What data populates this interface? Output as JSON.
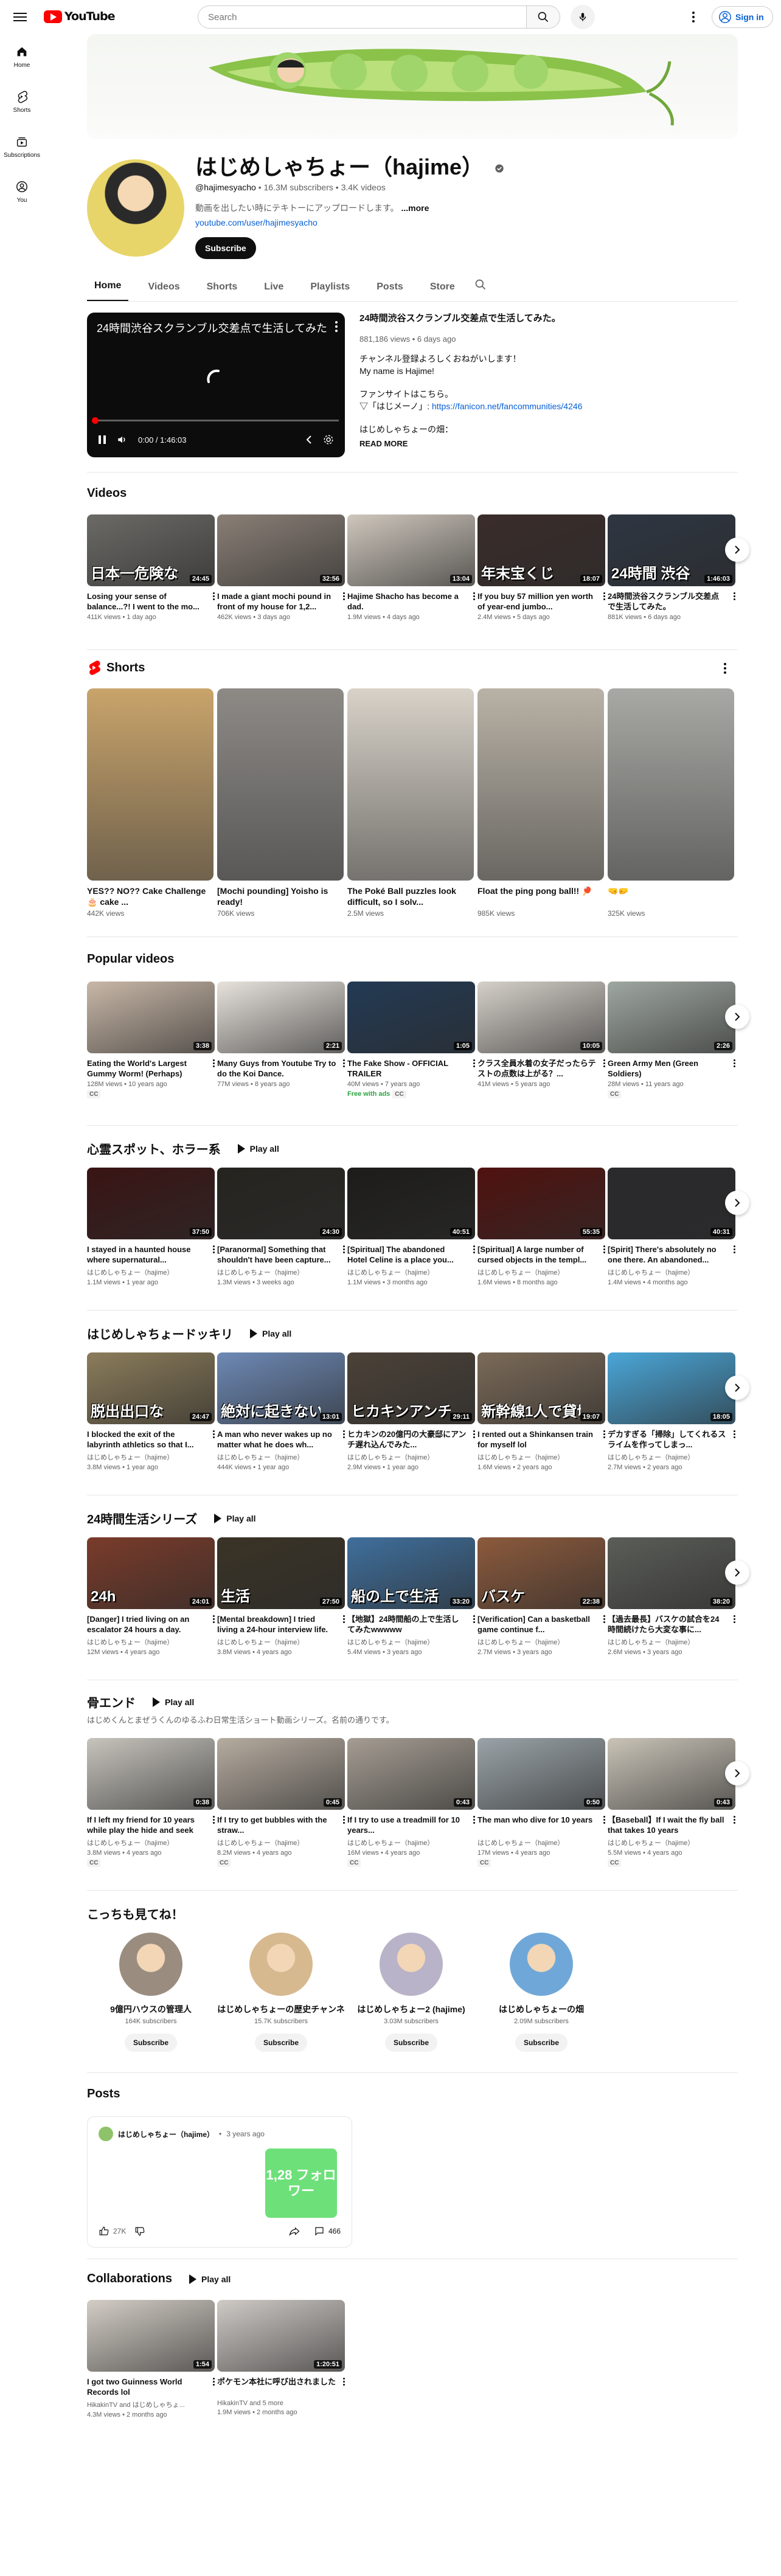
{
  "masthead": {
    "logo_text": "YouTube",
    "search_placeholder": "Search",
    "signin_label": "Sign in"
  },
  "guide": [
    {
      "label": "Home",
      "icon": "home-icon"
    },
    {
      "label": "Shorts",
      "icon": "shorts-icon"
    },
    {
      "label": "Subscriptions",
      "icon": "subscriptions-icon"
    },
    {
      "label": "You",
      "icon": "you-icon"
    }
  ],
  "channel": {
    "title": "はじめしゃちょー（hajime）",
    "handle": "@hajimesyacho",
    "subscribers": "16.3M subscribers",
    "videos": "3.4K videos",
    "description": "動画を出したい時にテキトーにアップロードします。",
    "more": "...more",
    "link": "youtube.com/user/hajimesyacho",
    "subscribe": "Subscribe"
  },
  "tabs": [
    "Home",
    "Videos",
    "Shorts",
    "Live",
    "Playlists",
    "Posts",
    "Store"
  ],
  "featured": {
    "player_title": "24時間渋谷スクランブル交差点で生活してみた。",
    "time": "0:00 / 1:46:03",
    "progress": 0,
    "title": "24時間渋谷スクランブル交差点で生活してみた。",
    "meta": "881,186 views • 6 days ago",
    "lines": [
      "チャンネル登録よろしくおねがいします！",
      "My name is Hajime!",
      "",
      "ファンサイトはこちら。",
      "はじめしゃちょーの畑："
    ],
    "fan_prefix": "▽「はじメーノ」: ",
    "fan_link": "https://fanicon.net/fancommunities/4246",
    "read_more": "READ MORE"
  },
  "sections": {
    "videos": {
      "title": "Videos",
      "items": [
        {
          "title": "Losing your sense of balance...?! I went to the mo...",
          "meta": "411K views • 1 day ago",
          "dur": "24:45",
          "caption": "日本一危険な",
          "color": "#6b6a66"
        },
        {
          "title": "I made a giant mochi pound in front of my house for 1,2...",
          "meta": "462K views • 3 days ago",
          "dur": "32:56",
          "caption": "",
          "color": "#8a7f76"
        },
        {
          "title": "Hajime Shacho has become a dad.",
          "meta": "1.9M views • 4 days ago",
          "dur": "13:04",
          "caption": "",
          "color": "#cfc7bd"
        },
        {
          "title": "If you buy 57 million yen worth of year-end jumbo...",
          "meta": "2.4M views • 5 days ago",
          "dur": "18:07",
          "caption": "年末宝くじ",
          "color": "#3a2c2a"
        },
        {
          "title": "24時間渋谷スクランブル交差点で生活してみた。",
          "meta": "881K views • 6 days ago",
          "dur": "1:46:03",
          "caption": "24時間 渋谷",
          "color": "#2e3642"
        }
      ]
    },
    "shorts": {
      "title": "Shorts",
      "items": [
        {
          "title": "YES?? NO?? Cake Challenge🎂 cake ...",
          "views": "442K views",
          "color": "#c9a46b"
        },
        {
          "title": "[Mochi pounding] Yoisho is ready!",
          "views": "706K views",
          "color": "#8d8a86"
        },
        {
          "title": "The Poké Ball puzzles look difficult, so I solv...",
          "views": "2.5M views",
          "color": "#d8d2c8"
        },
        {
          "title": "Float the ping pong ball!! 🏓",
          "views": "985K views",
          "color": "#b9b2a6"
        },
        {
          "title": "🤜🤛",
          "views": "325K views",
          "color": "#a8a8a4"
        }
      ]
    },
    "popular": {
      "title": "Popular videos",
      "items": [
        {
          "title": "Eating the World's Largest Gummy Worm! (Perhaps)",
          "meta": "128M views • 10 years ago",
          "dur": "3:38",
          "badges": [
            "CC"
          ],
          "color": "#c8b7a7"
        },
        {
          "title": "Many Guys from Youtube Try to do the Koi Dance.",
          "meta": "77M views • 8 years ago",
          "dur": "2:21",
          "badges": [],
          "color": "#e7e2dc"
        },
        {
          "title": "The Fake Show - OFFICIAL TRAILER",
          "meta": "40M views • 7 years ago",
          "dur": "1:05",
          "badges": [
            "Free with ads",
            "CC"
          ],
          "color": "#233a54"
        },
        {
          "title": "クラス全員水着の女子だったらテストの点数は上がる？...",
          "meta": "41M views • 5 years ago",
          "dur": "10:05",
          "badges": [],
          "color": "#d5d0c9"
        },
        {
          "title": "Green Army Men (Green Soldiers)",
          "meta": "28M views • 11 years ago",
          "dur": "2:26",
          "badges": [
            "CC"
          ],
          "color": "#9fa7a1"
        }
      ]
    },
    "horror": {
      "title": "心霊スポット、ホラー系",
      "play_all": "Play all",
      "items": [
        {
          "title": "I stayed in a haunted house where supernatural...",
          "channel": "はじめしゃちょー（hajime）",
          "meta": "1.1M views • 1 year ago",
          "dur": "37:50",
          "color": "#3a1414"
        },
        {
          "title": "[Paranormal] Something that shouldn't have been capture...",
          "channel": "はじめしゃちょー（hajime）",
          "meta": "1.3M views • 3 weeks ago",
          "dur": "24:30",
          "color": "#26241f"
        },
        {
          "title": "[Spiritual] The abandoned Hotel Celine is a place you...",
          "channel": "はじめしゃちょー（hajime）",
          "meta": "1.1M views • 3 months ago",
          "dur": "40:51",
          "color": "#1d1c1a"
        },
        {
          "title": "[Spiritual] A large number of cursed objects in the templ...",
          "channel": "はじめしゃちょー（hajime）",
          "meta": "1.6M views • 8 months ago",
          "dur": "55:35",
          "color": "#50120f"
        },
        {
          "title": "[Spirit] There's absolutely no one there. An abandoned...",
          "channel": "はじめしゃちょー（hajime）",
          "meta": "1.4M views • 4 months ago",
          "dur": "40:31",
          "color": "#2a2a2d"
        }
      ]
    },
    "dokkiri": {
      "title": "はじめしゃちょードッキリ",
      "play_all": "Play all",
      "items": [
        {
          "title": "I blocked the exit of the labyrinth athletics so that I...",
          "channel": "はじめしゃちょー（hajime）",
          "meta": "3.8M views • 1 year ago",
          "dur": "24:47",
          "caption": "脱出出口な",
          "color": "#8b7c5a"
        },
        {
          "title": "A man who never wakes up no matter what he does wh...",
          "channel": "はじめしゃちょー（hajime）",
          "meta": "444K views • 1 year ago",
          "dur": "13:01",
          "caption": "絶対に起きない",
          "color": "#6d89b5"
        },
        {
          "title": "ヒカキンの20億円の大豪邸にアンチ遅れ込んでみた...",
          "channel": "はじめしゃちょー（hajime）",
          "meta": "2.9M views • 1 year ago",
          "dur": "29:11",
          "caption": "ヒカキンアンチ",
          "color": "#4b4238"
        },
        {
          "title": "I rented out a Shinkansen train for myself lol",
          "channel": "はじめしゃちょー（hajime）",
          "meta": "1.6M views • 2 years ago",
          "dur": "19:07",
          "caption": "新幹線1人で貸切り",
          "color": "#7b6a58"
        },
        {
          "title": "デカすぎる「掃除」してくれるスライムを作ってしまっ...",
          "channel": "はじめしゃちょー（hajime）",
          "meta": "2.7M views • 2 years ago",
          "dur": "18:05",
          "caption": "",
          "color": "#4aa6d8"
        }
      ]
    },
    "life24": {
      "title": "24時間生活シリーズ",
      "play_all": "Play all",
      "items": [
        {
          "title": "[Danger] I tried living on an escalator 24 hours a day.",
          "channel": "はじめしゃちょー（hajime）",
          "meta": "12M views • 4 years ago",
          "dur": "24:01",
          "caption": "24h",
          "color": "#7a3b2a"
        },
        {
          "title": "[Mental breakdown] I tried living a 24-hour interview life.",
          "channel": "はじめしゃちょー（hajime）",
          "meta": "3.8M views • 4 years ago",
          "dur": "27:50",
          "caption": "生活",
          "color": "#3a3326"
        },
        {
          "title": "【地獄】24時間船の上で生活してみたwwwww",
          "channel": "はじめしゃちょー（hajime）",
          "meta": "5.4M views • 3 years ago",
          "dur": "33:20",
          "caption": "船の上で生活",
          "color": "#3f6f9c"
        },
        {
          "title": "[Verification] Can a basketball game continue f...",
          "channel": "はじめしゃちょー（hajime）",
          "meta": "2.7M views • 3 years ago",
          "dur": "22:38",
          "caption": "バスケ",
          "color": "#8c5a3c"
        },
        {
          "title": "【過去最長】バスケの試合を24時間続けたら大変な事に...",
          "channel": "はじめしゃちょー（hajime）",
          "meta": "2.6M views • 3 years ago",
          "dur": "38:20",
          "caption": "",
          "color": "#5b5d58"
        }
      ]
    },
    "hone": {
      "title": "骨エンド",
      "play_all": "Play all",
      "subtitle": "はじめくんとまぜうくんのゆるふわ日常生活ショート動画シリーズ。名前の通りです。",
      "items": [
        {
          "title": "If I left my friend for 10 years while play the hide and seek",
          "channel": "はじめしゃちょー（hajime）",
          "meta": "3.8M views • 4 years ago",
          "dur": "0:38",
          "badges": [
            "CC"
          ],
          "color": "#c7c4bd"
        },
        {
          "title": "If I try to get bubbles with the straw...",
          "channel": "はじめしゃちょー（hajime）",
          "meta": "8.2M views • 4 years ago",
          "dur": "0:45",
          "badges": [
            "CC"
          ],
          "color": "#b6aca0"
        },
        {
          "title": "If I try to use a treadmill for 10 years...",
          "channel": "はじめしゃちょー（hajime）",
          "meta": "16M views • 4 years ago",
          "dur": "0:43",
          "badges": [
            "CC"
          ],
          "color": "#a59d93"
        },
        {
          "title": "The man who dive for 10 years",
          "channel": "はじめしゃちょー（hajime）",
          "meta": "17M views • 4 years ago",
          "dur": "0:50",
          "badges": [
            "CC"
          ],
          "color": "#9aa3a8"
        },
        {
          "title": "【Baseball】If I wait the fly ball that takes 10 years",
          "channel": "はじめしゃちょー（hajime）",
          "meta": "5.5M views • 4 years ago",
          "dur": "0:43",
          "badges": [
            "CC"
          ],
          "color": "#c9c3b7"
        }
      ]
    },
    "channels": {
      "title": "こっちも見てね！",
      "items": [
        {
          "name": "9億円ハウスの管理人",
          "subs": "164K subscribers",
          "button": "Subscribe",
          "color": "#9a8d7f"
        },
        {
          "name": "はじめしゃちょーの歴史チャンネ",
          "subs": "15.7K subscribers",
          "button": "Subscribe",
          "color": "#d6b98f"
        },
        {
          "name": "はじめしゃちょー2 (hajime)",
          "subs": "3.03M subscribers",
          "button": "Subscribe",
          "color": "#b8b3c8"
        },
        {
          "name": "はじめしゃちょーの畑",
          "subs": "2.09M subscribers",
          "button": "Subscribe",
          "color": "#6fa8d8"
        }
      ]
    },
    "posts": {
      "title": "Posts",
      "author": "はじめしゃちょー（hajime）",
      "age": "3 years ago",
      "image_text": "1,28 フォロワー",
      "likes": "27K",
      "comments": "466"
    },
    "collabs": {
      "title": "Collaborations",
      "play_all": "Play all",
      "items": [
        {
          "title": "I got two Guinness World Records lol",
          "channel": "HikakinTV and はじめしゃちょ...",
          "meta": "4.3M views • 2 months ago",
          "dur": "1:54",
          "color": "#d3cdc5"
        },
        {
          "title": "ポケモン本社に呼び出されました",
          "channel": "HikakinTV and 5 more",
          "meta": "1.9M views • 2 months ago",
          "dur": "1:20:51",
          "color": "#cfcac6"
        }
      ]
    }
  }
}
